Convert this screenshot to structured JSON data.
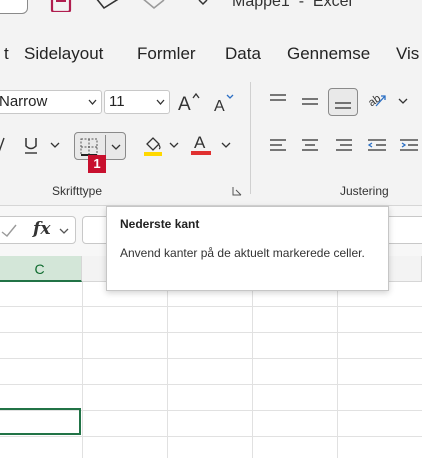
{
  "title_bar": {
    "document_title": "Mappe1  -  Excel",
    "icons": [
      "save-icon",
      "undo-icon",
      "redo-icon",
      "chevron-down-icon"
    ]
  },
  "ribbon_tabs": [
    "t",
    "Sidelayout",
    "Formler",
    "Data",
    "Gennemse",
    "Vis"
  ],
  "font_group": {
    "font_name": "Narrow",
    "font_size": "11",
    "label": "Skrifttype"
  },
  "alignment_group": {
    "label": "Justering"
  },
  "formula_bar": {
    "fx_label": "fx",
    "value": ""
  },
  "columns": {
    "selected": "C"
  },
  "tooltip": {
    "title": "Nederste kant",
    "body": "Anvend kanter på de aktuelt markerede celler."
  },
  "badge": "1",
  "colors": {
    "excel_green": "#217346",
    "highlight_yellow": "#ffd800",
    "font_red": "#e03030",
    "badge_red": "#c8102e"
  }
}
